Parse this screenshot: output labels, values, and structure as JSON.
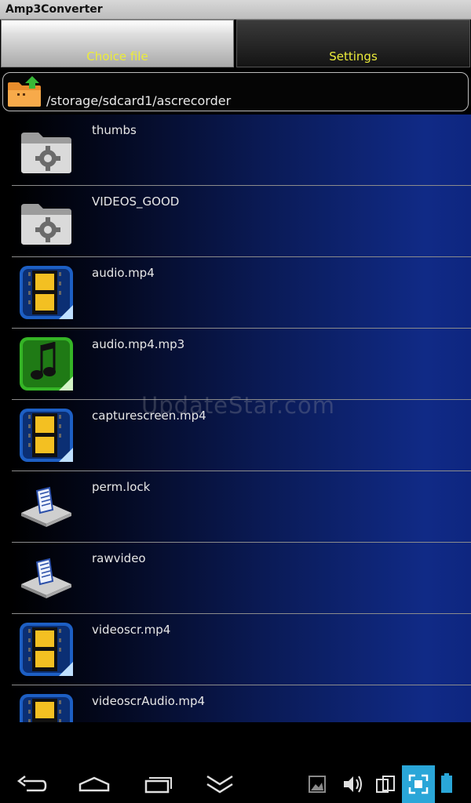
{
  "app": {
    "title": "Amp3Converter"
  },
  "tabs": [
    {
      "label": "Choice file",
      "selected": true
    },
    {
      "label": "Settings",
      "selected": false
    }
  ],
  "path": {
    "current": "/storage/sdcard1/ascrecorder",
    "icon": "folder-up-icon"
  },
  "files": [
    {
      "name": "thumbs",
      "icon": "folder-gear-icon"
    },
    {
      "name": "VIDEOS_GOOD",
      "icon": "folder-gear-icon"
    },
    {
      "name": "audio.mp4",
      "icon": "video-file-icon"
    },
    {
      "name": "audio.mp4.mp3",
      "icon": "music-file-icon"
    },
    {
      "name": "capturescreen.mp4",
      "icon": "video-file-icon"
    },
    {
      "name": "perm.lock",
      "icon": "document-file-icon"
    },
    {
      "name": "rawvideo",
      "icon": "document-file-icon"
    },
    {
      "name": "videoscr.mp4",
      "icon": "video-file-icon"
    },
    {
      "name": "videoscrAudio.mp4",
      "icon": "video-file-icon"
    }
  ],
  "watermark": "UpdateStar.com",
  "navbar": {
    "icons": [
      "back-icon",
      "home-icon",
      "recent-apps-icon",
      "hide-keyboard-icon",
      "gallery-icon",
      "volume-icon",
      "screen-rotate-icon",
      "fullscreen-icon",
      "battery-icon"
    ]
  },
  "colors": {
    "tab_text": "#ecec3a",
    "row_accent": "#102a86",
    "nav_highlight": "#2aa6d8"
  }
}
